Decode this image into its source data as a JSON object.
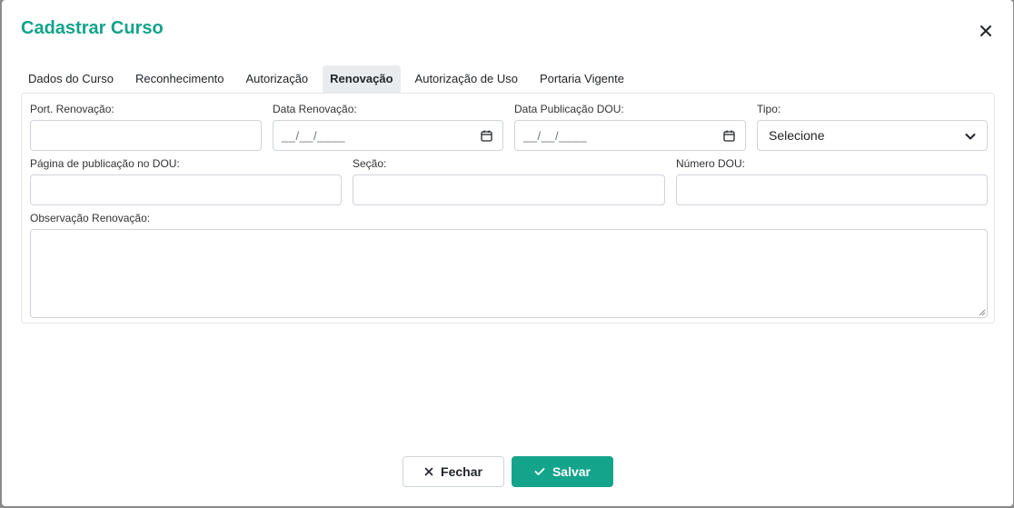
{
  "modal": {
    "title": "Cadastrar Curso"
  },
  "tabs": [
    {
      "label": "Dados do Curso"
    },
    {
      "label": "Reconhecimento"
    },
    {
      "label": "Autorização"
    },
    {
      "label": "Renovação"
    },
    {
      "label": "Autorização de Uso"
    },
    {
      "label": "Portaria Vigente"
    }
  ],
  "active_tab": "Renovação",
  "form": {
    "port_renovacao": {
      "label": "Port. Renovação:",
      "value": ""
    },
    "data_renovacao": {
      "label": "Data Renovação:",
      "placeholder": "__/__/____"
    },
    "data_publicacao_dou": {
      "label": "Data Publicação DOU:",
      "placeholder": "__/__/____"
    },
    "tipo": {
      "label": "Tipo:",
      "selected": "Selecione"
    },
    "pagina_publicacao": {
      "label": "Página de publicação no DOU:",
      "value": ""
    },
    "secao": {
      "label": "Seção:",
      "value": ""
    },
    "numero_dou": {
      "label": "Número DOU:",
      "value": ""
    },
    "observacao": {
      "label": "Observação Renovação:",
      "value": ""
    }
  },
  "footer": {
    "close_label": "Fechar",
    "save_label": "Salvar"
  },
  "colors": {
    "accent": "#14a38b",
    "tab_active_bg": "#e9ecef"
  }
}
